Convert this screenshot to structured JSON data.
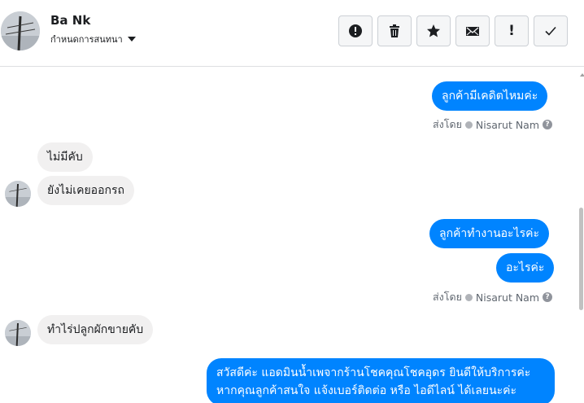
{
  "header": {
    "contact_name": "Ba Nk",
    "conversation_menu_label": "กำหนดการสนทนา"
  },
  "toolbar": {
    "buttons": [
      "report-spam",
      "delete",
      "star",
      "mark-unread",
      "important",
      "done"
    ]
  },
  "messages": {
    "m1": "ลูกค้ามีเคดิตไหมค่ะ",
    "m2": "ไม่มีคับ",
    "m3": "ยังไม่เคยออกรถ",
    "m4": "ลูกค้าทำงานอะไรค่ะ",
    "m5": "อะไรค่ะ",
    "m6": "ทำไร่ปลูกผักขายคับ",
    "m7_line1": "สวัสดีค่ะ แอดมินน้ำเพจากร้านโชคคุณโชคอุดร ยินดีให้บริการค่ะ",
    "m7_line2": "หากคุณลูกค้าสนใจ แจ้งเบอร์ติดต่อ หรือ ไอดีไลน์ ได้เลยนะค่ะ"
  },
  "sent_by": {
    "label": "ส่งโดย",
    "sender": "Nisarut Nam",
    "help": "?"
  },
  "colors": {
    "outgoing_bubble": "#0084ff",
    "incoming_bubble": "#f1f0f0",
    "meta_text": "#606770"
  }
}
